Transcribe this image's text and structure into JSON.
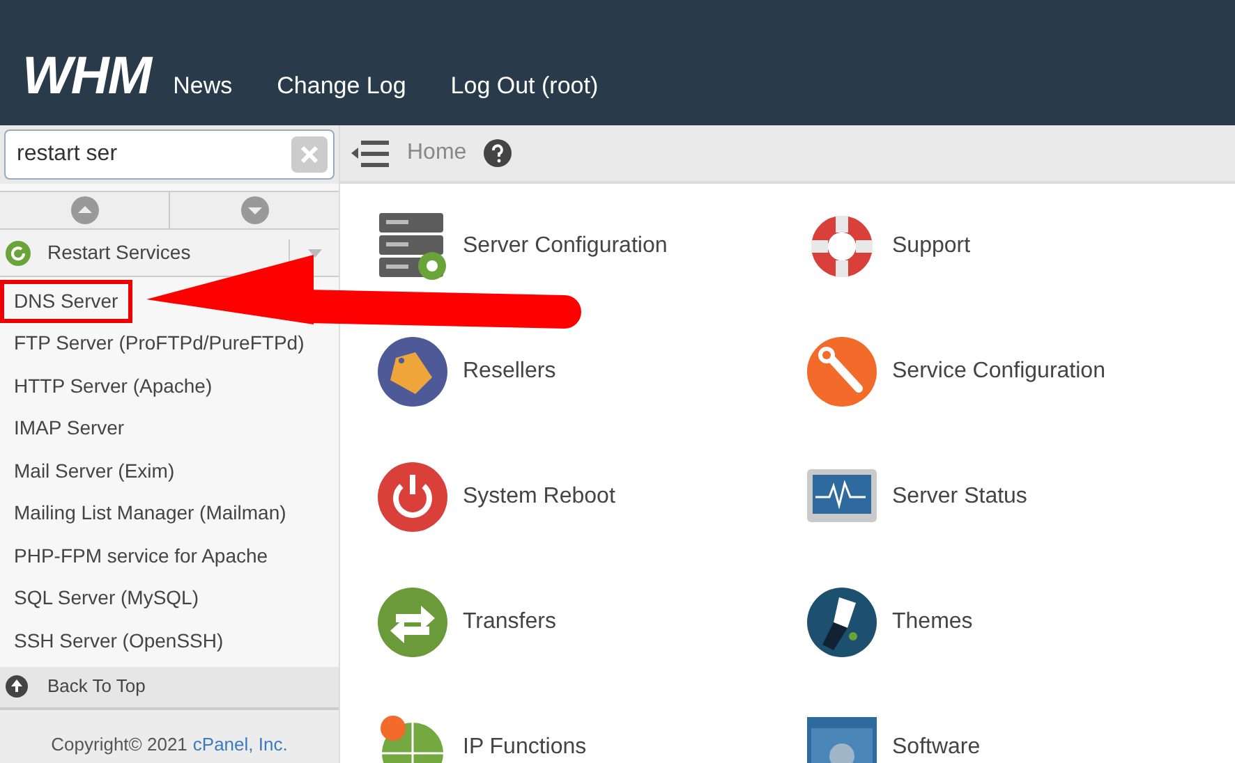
{
  "header": {
    "logo": "WHM",
    "nav": [
      {
        "label": "News"
      },
      {
        "label": "Change Log"
      },
      {
        "label": "Log Out (root)"
      }
    ]
  },
  "search": {
    "value": "restart ser"
  },
  "breadcrumb": {
    "label": "Home"
  },
  "sidebar": {
    "group": {
      "label": "Restart Services",
      "expanded": true
    },
    "items": [
      {
        "label": "DNS Server",
        "highlighted": true
      },
      {
        "label": "FTP Server (ProFTPd/PureFTPd)",
        "highlighted": false
      },
      {
        "label": "HTTP Server (Apache)",
        "highlighted": false
      },
      {
        "label": "IMAP Server",
        "highlighted": false
      },
      {
        "label": "Mail Server (Exim)",
        "highlighted": false
      },
      {
        "label": "Mailing List Manager (Mailman)",
        "highlighted": false
      },
      {
        "label": "PHP-FPM service for Apache",
        "highlighted": false
      },
      {
        "label": "SQL Server (MySQL)",
        "highlighted": false
      },
      {
        "label": "SSH Server (OpenSSH)",
        "highlighted": false
      }
    ],
    "back_to_top": "Back To Top",
    "copyright": "Copyright© 2021",
    "company_link": "cPanel, Inc."
  },
  "annotation": {
    "kind": "arrow"
  },
  "categories": [
    {
      "kind": "server",
      "label": "Server Configuration"
    },
    {
      "kind": "support",
      "label": "Support"
    },
    {
      "kind": "resellers",
      "label": "Resellers"
    },
    {
      "kind": "service",
      "label": "Service Configuration"
    },
    {
      "kind": "reboot",
      "label": "System Reboot"
    },
    {
      "kind": "status",
      "label": "Server Status"
    },
    {
      "kind": "transfers",
      "label": "Transfers"
    },
    {
      "kind": "themes",
      "label": "Themes"
    },
    {
      "kind": "ip",
      "label": "IP Functions"
    },
    {
      "kind": "software",
      "label": "Software"
    }
  ]
}
